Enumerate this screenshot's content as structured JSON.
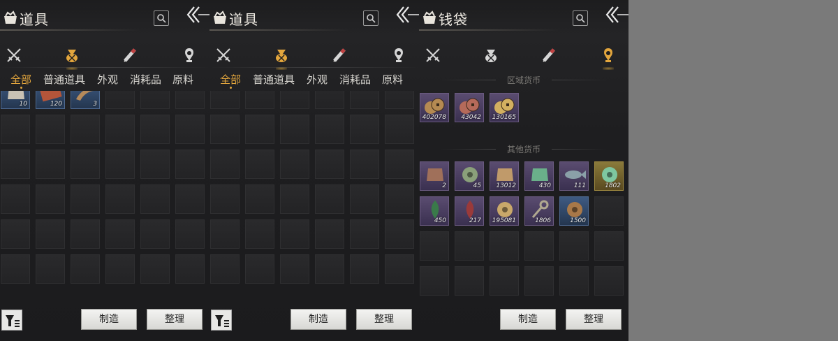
{
  "panels": [
    {
      "title": "道具",
      "active_category": 1,
      "subtabs": [
        "全部",
        "普通道具",
        "外观",
        "消耗品",
        "原料"
      ],
      "active_subtab": 0,
      "items": [
        {
          "count": "10",
          "icon": "gourd-icon"
        },
        {
          "count": "120",
          "icon": "book-icon"
        },
        {
          "count": "3",
          "icon": "horn-icon"
        }
      ],
      "make_label": "制造",
      "sort_label": "整理"
    },
    {
      "title": "道具",
      "active_category": 1,
      "subtabs": [
        "全部",
        "普通道具",
        "外观",
        "消耗品",
        "原料"
      ],
      "active_subtab": 0,
      "items": [],
      "make_label": "制造",
      "sort_label": "整理"
    },
    {
      "title": "钱袋",
      "active_category": 3,
      "section_regional": "区域货币",
      "section_other": "其他货币",
      "regional_items": [
        {
          "count": "402078",
          "icon": "copper-coins-icon"
        },
        {
          "count": "43042",
          "icon": "red-coins-icon"
        },
        {
          "count": "130165",
          "icon": "gold-coins-icon"
        }
      ],
      "other_items": [
        {
          "count": "2",
          "icon": "token-icon",
          "tier": "purple"
        },
        {
          "count": "45",
          "icon": "jade-coin-icon",
          "tier": "purple"
        },
        {
          "count": "13012",
          "icon": "shell-icon",
          "tier": "purple"
        },
        {
          "count": "430",
          "icon": "jade-piece-icon",
          "tier": "purple"
        },
        {
          "count": "111",
          "icon": "fish-icon",
          "tier": "purple"
        },
        {
          "count": "1802",
          "icon": "jade-ring-icon",
          "tier": "gold"
        },
        {
          "count": "450",
          "icon": "green-feather-icon",
          "tier": "purple"
        },
        {
          "count": "217",
          "icon": "red-feather-icon",
          "tier": "purple"
        },
        {
          "count": "195081",
          "icon": "gold-ring-icon",
          "tier": "purple"
        },
        {
          "count": "1806",
          "icon": "key-icon",
          "tier": "purple"
        },
        {
          "count": "1500",
          "icon": "copper-coin-icon",
          "tier": "blue"
        }
      ],
      "make_label": "制造",
      "sort_label": "整理"
    }
  ],
  "icons": {
    "categories": [
      "crossed-swords-icon",
      "money-bag-icon",
      "scroll-icon",
      "pendant-icon"
    ]
  },
  "colors": {
    "accent": "#e3a63d",
    "text": "#d8d6d0",
    "background": "#1e1e20"
  }
}
